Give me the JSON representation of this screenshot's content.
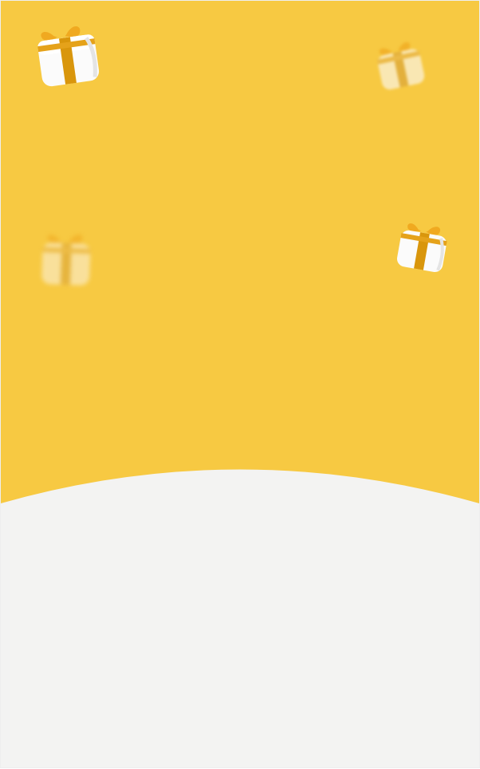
{
  "theme": {
    "accent": "#f7c942",
    "surface": "#f3f3f2",
    "ribbon": "#d9960c"
  },
  "decorations": {
    "gift_icon": "gift-box-icon",
    "count": 4
  }
}
